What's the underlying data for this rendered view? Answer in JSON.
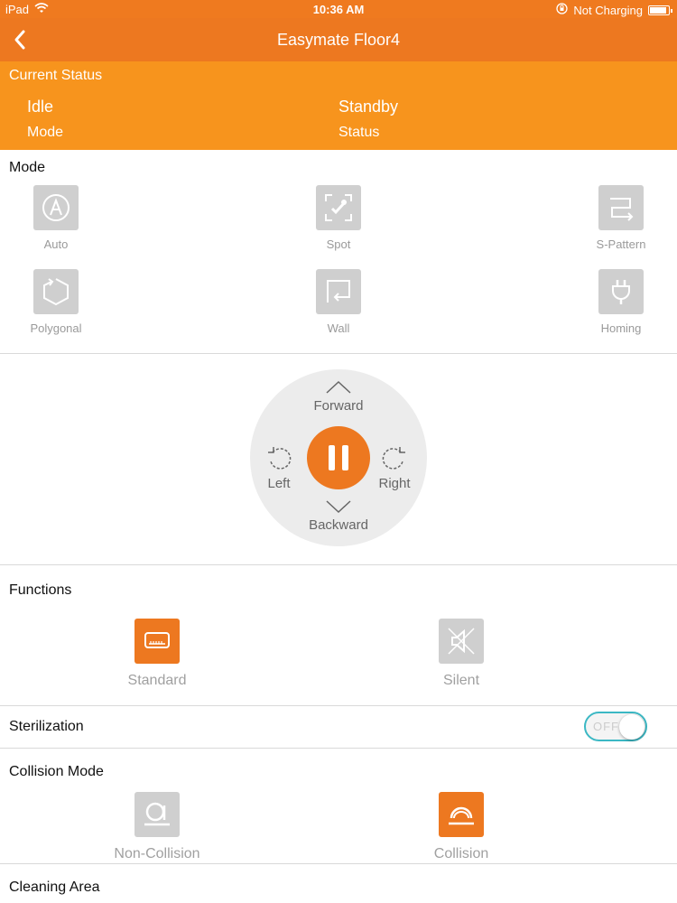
{
  "status_bar": {
    "device": "iPad",
    "time": "10:36 AM",
    "charging": "Not Charging",
    "icons": [
      "wifi-icon",
      "orientation-lock-icon",
      "battery-icon"
    ]
  },
  "nav": {
    "title": "Easymate Floor4",
    "back_icon": "chevron-left-icon"
  },
  "current_status": {
    "header": "Current Status",
    "mode_value": "Idle",
    "mode_label": "Mode",
    "status_value": "Standby",
    "status_label": "Status"
  },
  "mode": {
    "title": "Mode",
    "items": [
      {
        "label": "Auto",
        "icon": "auto-a-icon"
      },
      {
        "label": "Spot",
        "icon": "spot-target-icon"
      },
      {
        "label": "S-Pattern",
        "icon": "s-pattern-icon"
      },
      {
        "label": "Polygonal",
        "icon": "polygon-icon"
      },
      {
        "label": "Wall",
        "icon": "wall-icon"
      },
      {
        "label": "Homing",
        "icon": "plug-icon"
      }
    ]
  },
  "control": {
    "forward": "Forward",
    "backward": "Backward",
    "left": "Left",
    "right": "Right",
    "center_icon": "pause-icon"
  },
  "functions": {
    "title": "Functions",
    "items": [
      {
        "label": "Standard",
        "icon": "standard-fan-icon",
        "active": true
      },
      {
        "label": "Silent",
        "icon": "mute-icon",
        "active": false
      }
    ]
  },
  "sterilization": {
    "label": "Sterilization",
    "toggle_text": "OFF",
    "on": false
  },
  "collision": {
    "title": "Collision Mode",
    "items": [
      {
        "label": "Non-Collision",
        "icon": "non-collision-icon",
        "active": false
      },
      {
        "label": "Collision",
        "icon": "collision-icon",
        "active": true
      }
    ]
  },
  "cleaning_area": {
    "title": "Cleaning Area"
  },
  "colors": {
    "primary": "#ED7820",
    "status_panel": "#F7941D",
    "icon_inactive": "#CFCFCF",
    "toggle_border": "#3BB8C4"
  }
}
